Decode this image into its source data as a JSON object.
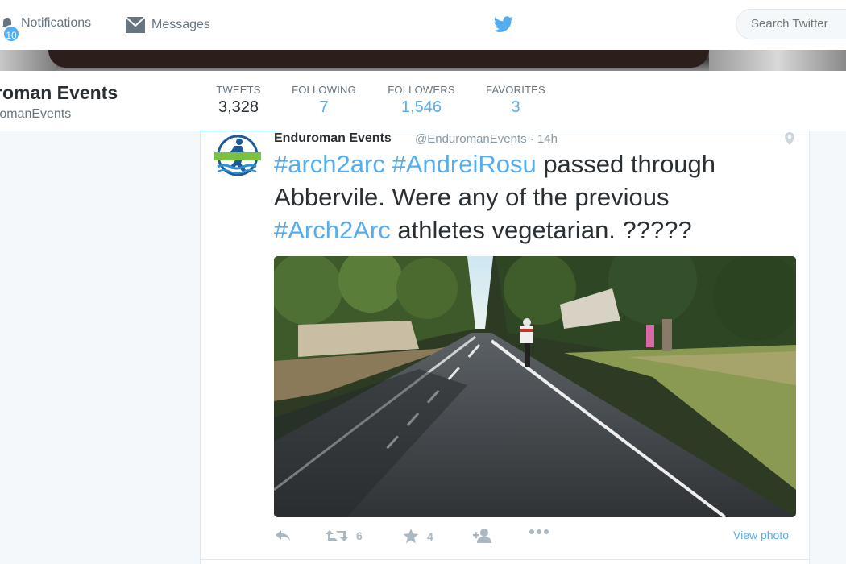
{
  "topnav": {
    "notifications_label": "Notifications",
    "notifications_count": "10",
    "messages_label": "Messages",
    "search_placeholder": "Search Twitter"
  },
  "profile": {
    "name": "roman Events",
    "handle": "romanEvents",
    "stats": [
      {
        "label": "TWEETS",
        "value": "3,328"
      },
      {
        "label": "FOLLOWING",
        "value": "7"
      },
      {
        "label": "FOLLOWERS",
        "value": "1,546"
      },
      {
        "label": "FAVORITES",
        "value": "3"
      }
    ]
  },
  "tweet": {
    "author": "Enduroman Events",
    "handle_time": "@EnduromanEvents · 14h",
    "text": {
      "tag1": "#arch2arc",
      "tag2": "#AndreiRosu",
      "part1": " passed through Abbervile. Were any of the previous ",
      "tag3": "#Arch2Arc",
      "part2": " athletes vegetarian.  ?????"
    },
    "retweets": "6",
    "favorites": "4",
    "view_photo": "View photo"
  },
  "colors": {
    "accent": "#55acee",
    "text": "#292f33",
    "muted": "#66757f"
  }
}
